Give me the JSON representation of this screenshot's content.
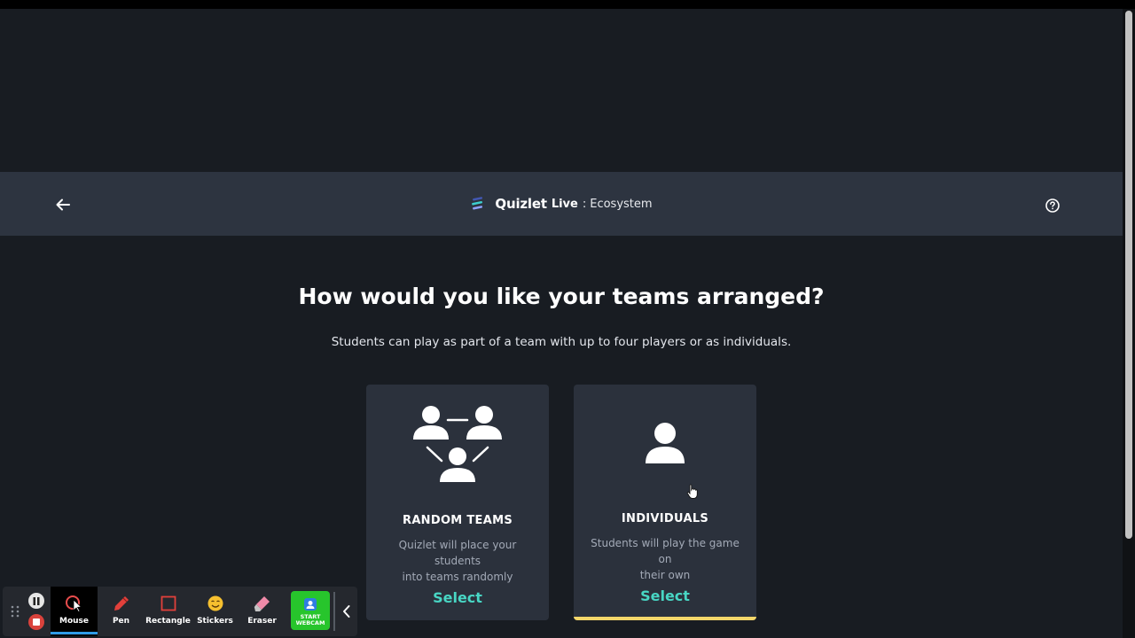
{
  "header": {
    "brand_name": "Quizlet",
    "brand_product": "Live",
    "separator": ":",
    "set_name": "Ecosystem"
  },
  "main": {
    "heading": "How would you like your teams arranged?",
    "subheading": "Students can play as part of a team with up to four players or as individuals."
  },
  "cards": [
    {
      "title": "RANDOM TEAMS",
      "desc_line1": "Quizlet will place your students",
      "desc_line2": "into teams randomly",
      "select_label": "Select",
      "icon": "team-icon"
    },
    {
      "title": "INDIVIDUALS",
      "desc_line1": "Students will play the game on",
      "desc_line2": "their own",
      "select_label": "Select",
      "icon": "person-icon"
    }
  ],
  "toolbar": {
    "tools": [
      {
        "label": "Mouse",
        "icon": "mouse-pointer-icon"
      },
      {
        "label": "Pen",
        "icon": "pen-icon"
      },
      {
        "label": "Rectangle",
        "icon": "rectangle-icon"
      },
      {
        "label": "Stickers",
        "icon": "sticker-icon"
      },
      {
        "label": "Eraser",
        "icon": "eraser-icon"
      }
    ],
    "webcam_line1": "START",
    "webcam_line2": "WEBCAM"
  },
  "colors": {
    "accent_select": "#48d6c4",
    "selected_underline": "#f5d76a",
    "webcam_green": "#27c52c",
    "stop_red": "#d9423c"
  }
}
